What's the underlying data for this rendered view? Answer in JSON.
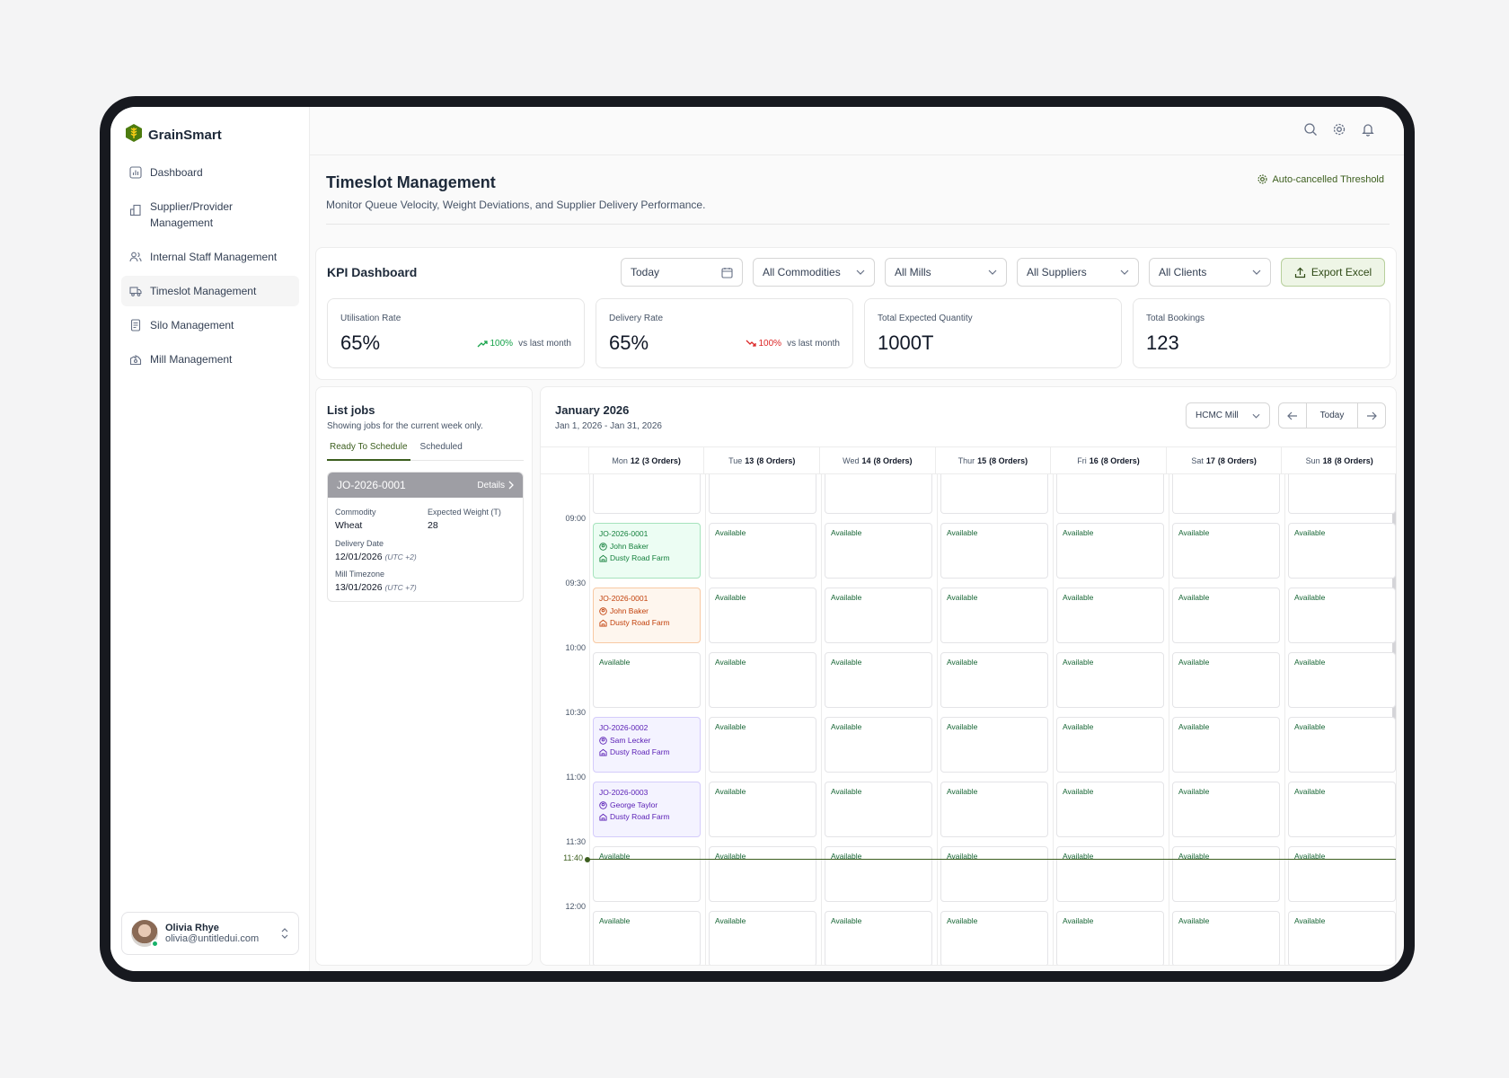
{
  "app": {
    "name": "GrainSmart"
  },
  "sidebar": {
    "items": [
      {
        "label": "Dashboard",
        "icon": "chart-icon"
      },
      {
        "label": "Supplier/Provider Management",
        "icon": "building-icon"
      },
      {
        "label": "Internal Staff Management",
        "icon": "users-icon"
      },
      {
        "label": "Timeslot Management",
        "icon": "truck-icon",
        "active": true
      },
      {
        "label": "Silo Management",
        "icon": "document-icon"
      },
      {
        "label": "Mill Management",
        "icon": "factory-icon"
      }
    ],
    "user": {
      "name": "Olivia Rhye",
      "email": "olivia@untitledui.com"
    }
  },
  "page": {
    "title": "Timeslot Management",
    "subtitle": "Monitor Queue Velocity, Weight Deviations, and Supplier Delivery Performance.",
    "threshold_label": "Auto-cancelled Threshold"
  },
  "kpi": {
    "title": "KPI Dashboard",
    "filters": {
      "date": "Today",
      "commodities": "All Commodities",
      "mills": "All Mills",
      "suppliers": "All Suppliers",
      "clients": "All Clients"
    },
    "export_label": "Export Excel",
    "stats": [
      {
        "label": "Utilisation Rate",
        "value": "65%",
        "delta": "100%",
        "delta_text": "vs last month",
        "trend": "up"
      },
      {
        "label": "Delivery Rate",
        "value": "65%",
        "delta": "100%",
        "delta_text": "vs last month",
        "trend": "down"
      },
      {
        "label": "Total Expected Quantity",
        "value": "1000T"
      },
      {
        "label": "Total Bookings",
        "value": "123"
      }
    ]
  },
  "jobs": {
    "title": "List jobs",
    "subtitle": "Showing jobs for the current week only.",
    "tabs": [
      "Ready To Schedule",
      "Scheduled"
    ],
    "card": {
      "id": "JO-2026-0001",
      "details_label": "Details",
      "commodity_label": "Commodity",
      "commodity": "Wheat",
      "weight_label": "Expected Weight (T)",
      "weight": "28",
      "delivery_label": "Delivery Date",
      "delivery": "12/01/2026",
      "delivery_tz": "(UTC +2)",
      "mill_tz_label": "Mill Timezone",
      "mill_tz": "13/01/2026",
      "mill_tz_tz": "(UTC +7)"
    }
  },
  "calendar": {
    "title": "January 2026",
    "range": "Jan 1, 2026 - Jan 31, 2026",
    "mill": "HCMC Mill",
    "today_label": "Today",
    "days": [
      {
        "name": "Mon",
        "num": "12",
        "orders": "(3 Orders)"
      },
      {
        "name": "Tue",
        "num": "13",
        "orders": "(8 Orders)"
      },
      {
        "name": "Wed",
        "num": "14",
        "orders": "(8 Orders)"
      },
      {
        "name": "Thur",
        "num": "15",
        "orders": "(8 Orders)"
      },
      {
        "name": "Fri",
        "num": "16",
        "orders": "(8 Orders)"
      },
      {
        "name": "Sat",
        "num": "17",
        "orders": "(8 Orders)"
      },
      {
        "name": "Sun",
        "num": "18",
        "orders": "(8 Orders)"
      }
    ],
    "times": [
      "09:00",
      "09:30",
      "10:00",
      "10:30",
      "11:00",
      "11:30",
      "12:00"
    ],
    "now": "11:40",
    "available_label": "Available",
    "events": [
      {
        "row": 0,
        "id": "JO-2026-0001",
        "person": "John Baker",
        "farm": "Dusty Road Farm",
        "color": "green"
      },
      {
        "row": 1,
        "id": "JO-2026-0001",
        "person": "John Baker",
        "farm": "Dusty Road Farm",
        "color": "orange"
      },
      {
        "row": 3,
        "id": "JO-2026-0002",
        "person": "Sam Lecker",
        "farm": "Dusty Road Farm",
        "color": "purple"
      },
      {
        "row": 4,
        "id": "JO-2026-0003",
        "person": "George Taylor",
        "farm": "Dusty Road Farm",
        "color": "purple"
      }
    ]
  }
}
